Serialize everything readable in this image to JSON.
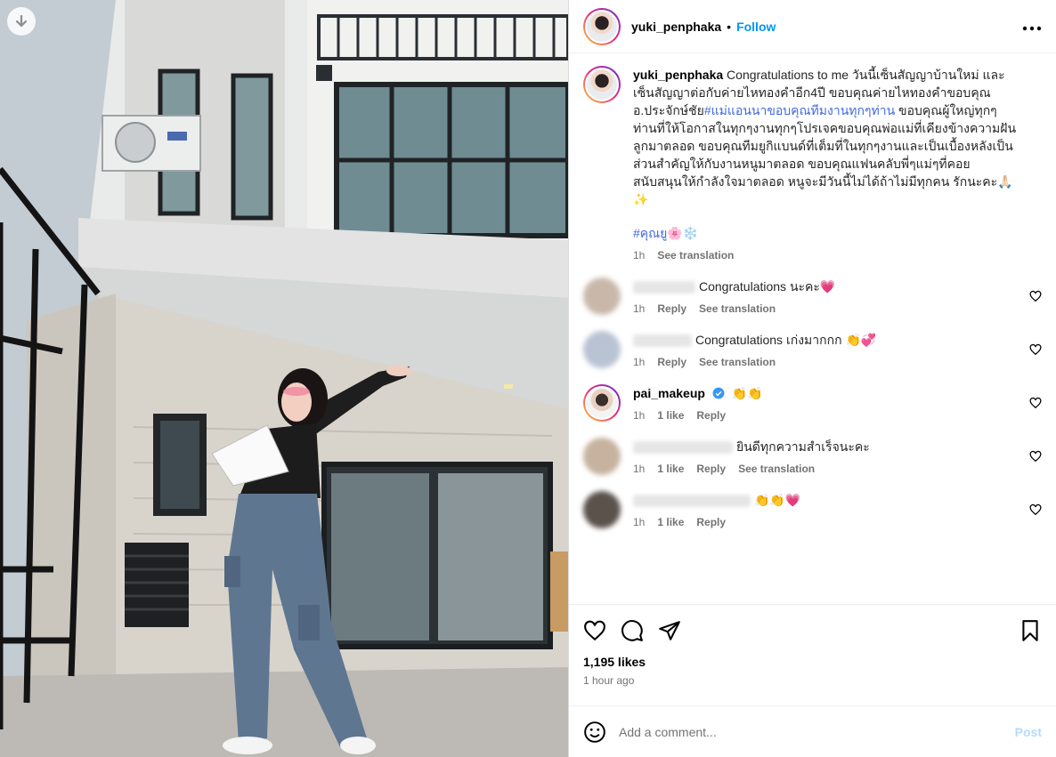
{
  "post": {
    "author": "yuki_penphaka",
    "follow_label": "Follow",
    "dot": "•",
    "more_label": "•••",
    "caption": {
      "username": "yuki_penphaka",
      "text_part1": "Congratulations to me วันนี้เซ็นสัญญาบ้านใหม่ และเซ็นสัญญาต่อกับค่ายไหทองคำอีก4ปี ขอบคุณค่ายไหทองคำขอบคุณ อ.ประจักษ์ชัย",
      "hashtag_inline": "#แม่แอนนาขอบคุณทีมงานทุกๆท่าน",
      "text_part2": " ขอบคุณผู้ใหญ่ทุกๆท่านที่ให้โอกาสในทุกๆงานทุกๆโปรเจคขอบคุณพ่อแม่ที่เคียงข้างความฝันลูกมาตลอด ขอบคุณทีมยูกิแบนด์ที่เต็มที่ในทุกๆงานและเป็นเบื้องหลังเป็นส่วนสำคัญให้กับงานหนูมาตลอด ขอบคุณแฟนคลับพี่ๆแม่ๆที่คอยสนับสนุนให้กำลังใจมาตลอด หนูจะมีวันนี้ไม่ได้ถ้าไม่มีทุกคน รักนะคะ🙏🏻✨",
      "hashtag_line": "#คุณยู🌸❄️",
      "time": "1h",
      "see_translation": "See translation"
    },
    "comments": [
      {
        "text": "Congratulations นะคะ💗",
        "time": "1h",
        "likes": "",
        "reply": "Reply",
        "see_translation": "See translation",
        "blurred": true,
        "avatar_color": "#c9b8aa"
      },
      {
        "text": "Congratulations เก่งมากกก 👏💞",
        "time": "1h",
        "likes": "",
        "reply": "Reply",
        "see_translation": "See translation",
        "blurred": true,
        "avatar_color": "#b9c3d3"
      },
      {
        "username": "pai_makeup",
        "text": "👏👏",
        "time": "1h",
        "likes": "1 like",
        "reply": "Reply",
        "see_translation": "",
        "blurred": false
      },
      {
        "text": "ยินดีทุกความสำเร็จนะคะ",
        "time": "1h",
        "likes": "1 like",
        "reply": "Reply",
        "see_translation": "See translation",
        "blurred": true,
        "avatar_color": "#c7b29f"
      },
      {
        "text": "👏👏💗",
        "time": "1h",
        "likes": "1 like",
        "reply": "Reply",
        "see_translation": "",
        "blurred": true,
        "avatar_color": "#5b524c"
      }
    ],
    "likes": "1,195 likes",
    "posted_ago": "1 hour ago",
    "add_comment_placeholder": "Add a comment...",
    "post_label": "Post"
  },
  "colors": {
    "accent": "#0095f6",
    "hashtag": "#4169e1",
    "muted": "#737373",
    "verified": "#3897f0"
  }
}
